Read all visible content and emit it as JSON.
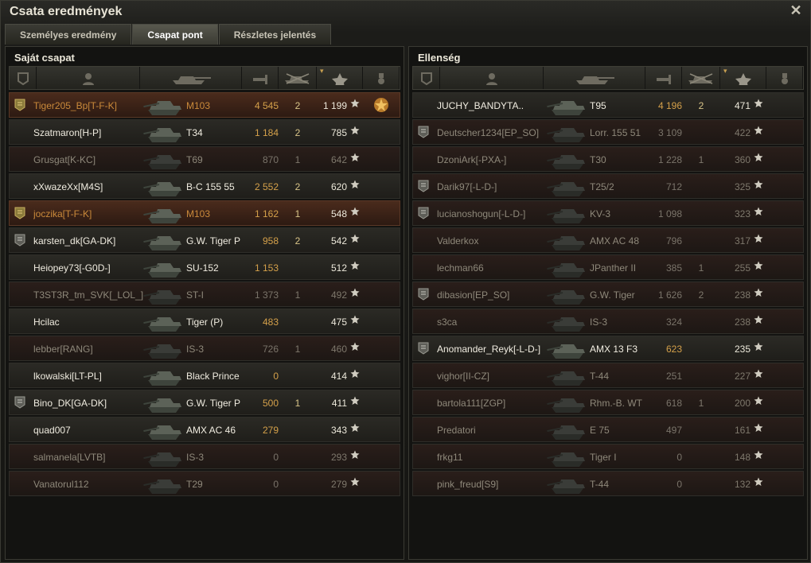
{
  "window": {
    "title": "Csata eredmények",
    "close_icon": "close-icon"
  },
  "tabs": [
    {
      "label": "Személyes eredmény",
      "active": false
    },
    {
      "label": "Csapat pont",
      "active": true
    },
    {
      "label": "Részletes jelentés",
      "active": false
    }
  ],
  "header_icons": [
    "badge-icon",
    "player-icon",
    "tank-icon",
    "damage-icon",
    "kills-icon",
    "points-icon",
    "medal-icon"
  ],
  "teams": [
    {
      "title": "Saját csapat",
      "rows": [
        {
          "player": "Tiger205_Bp[T-F-K]",
          "tank": "M103",
          "damage": "4 545",
          "kills": "2",
          "points": "1 199",
          "state": "self",
          "badge": true,
          "medal": true
        },
        {
          "player": "Szatmaron[H-P]",
          "tank": "T34",
          "damage": "1 184",
          "kills": "2",
          "points": "785",
          "state": "alive",
          "badge": false,
          "medal": false
        },
        {
          "player": "Grusgat[K-KC]",
          "tank": "T69",
          "damage": "870",
          "kills": "1",
          "points": "642",
          "state": "dead",
          "badge": false,
          "medal": false
        },
        {
          "player": "xXwazeXx[M4S]",
          "tank": "B-C 155 55",
          "damage": "2 552",
          "kills": "2",
          "points": "620",
          "state": "alive",
          "badge": false,
          "medal": false
        },
        {
          "player": "joczika[T-F-K]",
          "tank": "M103",
          "damage": "1 162",
          "kills": "1",
          "points": "548",
          "state": "self",
          "badge": true,
          "medal": false
        },
        {
          "player": "karsten_dk[GA-DK]",
          "tank": "G.W. Tiger P",
          "damage": "958",
          "kills": "2",
          "points": "542",
          "state": "alive",
          "badge": true,
          "medal": false
        },
        {
          "player": "Heiopey73[-G0D-]",
          "tank": "SU-152",
          "damage": "1 153",
          "kills": "",
          "points": "512",
          "state": "alive",
          "badge": false,
          "medal": false
        },
        {
          "player": "T3ST3R_tm_SVK[_LOL_]",
          "tank": "ST-I",
          "damage": "1 373",
          "kills": "1",
          "points": "492",
          "state": "dead",
          "badge": false,
          "medal": false
        },
        {
          "player": "Hcilac",
          "tank": "Tiger (P)",
          "damage": "483",
          "kills": "",
          "points": "475",
          "state": "alive",
          "badge": false,
          "medal": false
        },
        {
          "player": "lebber[RANG]",
          "tank": "IS-3",
          "damage": "726",
          "kills": "1",
          "points": "460",
          "state": "dead",
          "badge": false,
          "medal": false
        },
        {
          "player": "lkowalski[LT-PL]",
          "tank": "Black Prince",
          "damage": "0",
          "kills": "",
          "points": "414",
          "state": "alive",
          "badge": false,
          "medal": false
        },
        {
          "player": "Bino_DK[GA-DK]",
          "tank": "G.W. Tiger P",
          "damage": "500",
          "kills": "1",
          "points": "411",
          "state": "alive",
          "badge": true,
          "medal": false
        },
        {
          "player": "quad007",
          "tank": "AMX AC 46",
          "damage": "279",
          "kills": "",
          "points": "343",
          "state": "alive",
          "badge": false,
          "medal": false
        },
        {
          "player": "salmanela[LVTB]",
          "tank": "IS-3",
          "damage": "0",
          "kills": "",
          "points": "293",
          "state": "dead",
          "badge": false,
          "medal": false
        },
        {
          "player": "Vanatorul112",
          "tank": "T29",
          "damage": "0",
          "kills": "",
          "points": "279",
          "state": "dead",
          "badge": false,
          "medal": false
        }
      ]
    },
    {
      "title": "Ellenség",
      "rows": [
        {
          "player": "JUCHY_BANDYTA..",
          "tank": "T95",
          "damage": "4 196",
          "kills": "2",
          "points": "471",
          "state": "alive",
          "badge": false,
          "medal": false
        },
        {
          "player": "Deutscher1234[EP_SO]",
          "tank": "Lorr. 155 51",
          "damage": "3 109",
          "kills": "",
          "points": "422",
          "state": "dead",
          "badge": true,
          "medal": false
        },
        {
          "player": "DzoniArk[-PXA-]",
          "tank": "T30",
          "damage": "1 228",
          "kills": "1",
          "points": "360",
          "state": "dead",
          "badge": false,
          "medal": false
        },
        {
          "player": "Darik97[-L-D-]",
          "tank": "T25/2",
          "damage": "712",
          "kills": "",
          "points": "325",
          "state": "dead",
          "badge": true,
          "medal": false
        },
        {
          "player": "lucianoshogun[-L-D-]",
          "tank": "KV-3",
          "damage": "1 098",
          "kills": "",
          "points": "323",
          "state": "dead",
          "badge": true,
          "medal": false
        },
        {
          "player": "Valderkox",
          "tank": "AMX AC 48",
          "damage": "796",
          "kills": "",
          "points": "317",
          "state": "dead",
          "badge": false,
          "medal": false
        },
        {
          "player": "lechman66",
          "tank": "JPanther II",
          "damage": "385",
          "kills": "1",
          "points": "255",
          "state": "dead",
          "badge": false,
          "medal": false
        },
        {
          "player": "dibasion[EP_SO]",
          "tank": "G.W. Tiger",
          "damage": "1 626",
          "kills": "2",
          "points": "238",
          "state": "dead",
          "badge": true,
          "medal": false
        },
        {
          "player": "s3ca",
          "tank": "IS-3",
          "damage": "324",
          "kills": "",
          "points": "238",
          "state": "dead",
          "badge": false,
          "medal": false
        },
        {
          "player": "Anomander_Reyk[-L-D-]",
          "tank": "AMX 13 F3",
          "damage": "623",
          "kills": "",
          "points": "235",
          "state": "alive",
          "badge": true,
          "medal": false
        },
        {
          "player": "vighor[II-CZ]",
          "tank": "T-44",
          "damage": "251",
          "kills": "",
          "points": "227",
          "state": "dead",
          "badge": false,
          "medal": false
        },
        {
          "player": "bartola111[ZGP]",
          "tank": "Rhm.-B. WT",
          "damage": "618",
          "kills": "1",
          "points": "200",
          "state": "dead",
          "badge": false,
          "medal": false
        },
        {
          "player": "Predatori",
          "tank": "E 75",
          "damage": "497",
          "kills": "",
          "points": "161",
          "state": "dead",
          "badge": false,
          "medal": false
        },
        {
          "player": "frkg11",
          "tank": "Tiger I",
          "damage": "0",
          "kills": "",
          "points": "148",
          "state": "dead",
          "badge": false,
          "medal": false
        },
        {
          "player": "pink_freud[S9]",
          "tank": "T-44",
          "damage": "0",
          "kills": "",
          "points": "132",
          "state": "dead",
          "badge": false,
          "medal": false
        }
      ]
    }
  ],
  "colors": {
    "self": "#c9893a",
    "damage": "#d4a04a",
    "text": "#f0ece0",
    "dead_text": "#8e887a"
  }
}
